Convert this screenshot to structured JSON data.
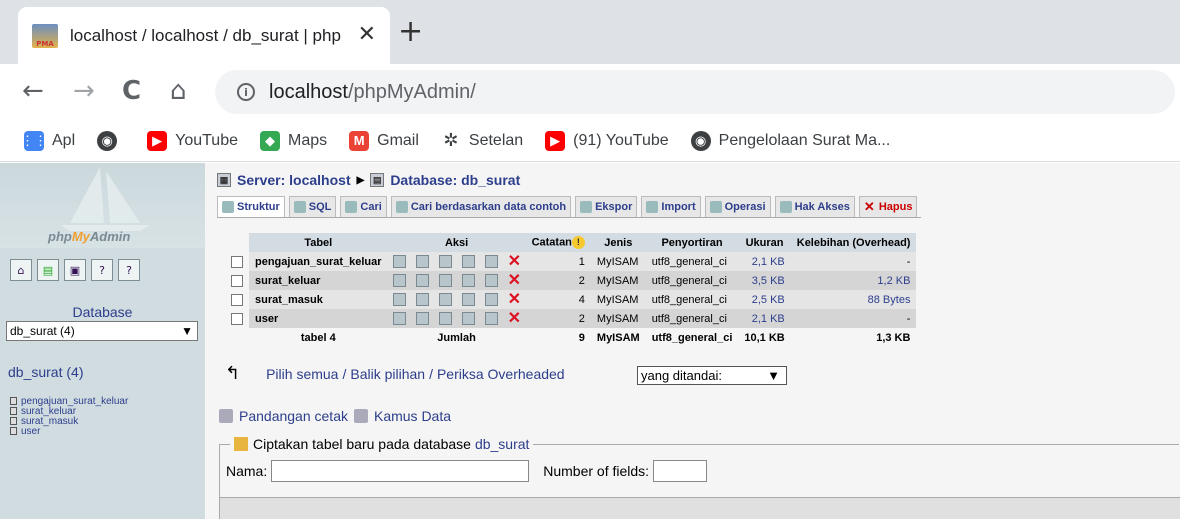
{
  "browser": {
    "tab_title": "localhost / localhost / db_surat | php",
    "tab_close": "✕",
    "new_tab": "+",
    "nav": {
      "back": "←",
      "forward": "→",
      "reload": "C",
      "home": "⌂"
    },
    "url_host": "localhost",
    "url_path": "/phpMyAdmin/",
    "bookmarks": [
      {
        "label": "Apl",
        "icon": "apps-grid-icon",
        "color": "#4285f4"
      },
      {
        "label": "",
        "icon": "globe-icon",
        "color": "#3c4043"
      },
      {
        "label": "YouTube",
        "icon": "youtube-icon",
        "color": "#ff0000"
      },
      {
        "label": "Maps",
        "icon": "maps-icon",
        "color": "#34a853"
      },
      {
        "label": "Gmail",
        "icon": "gmail-icon",
        "color": "#ea4335"
      },
      {
        "label": "Setelan",
        "icon": "gear-icon",
        "color": "#3c4043"
      },
      {
        "label": "(91) YouTube",
        "icon": "youtube-icon",
        "color": "#ff0000"
      },
      {
        "label": "Pengelolaan Surat Ma...",
        "icon": "globe-icon",
        "color": "#3c4043"
      }
    ]
  },
  "left": {
    "logo_php": "php",
    "logo_my": "My",
    "logo_admin": "Admin",
    "db_label": "Database",
    "db_select": "db_surat (4)",
    "db_title": "db_surat (4)",
    "tables": [
      "pengajuan_surat_keluar",
      "surat_keluar",
      "surat_masuk",
      "user"
    ]
  },
  "right": {
    "server": "Server: localhost",
    "database": "Database: db_surat",
    "tabs": [
      "Struktur",
      "SQL",
      "Cari",
      "Cari berdasarkan data contoh",
      "Ekspor",
      "Import",
      "Operasi",
      "Hak Akses",
      "Hapus"
    ],
    "table": {
      "headers": {
        "tabel": "Tabel",
        "aksi": "Aksi",
        "catatan": "Catatan",
        "jenis": "Jenis",
        "penyortiran": "Penyortiran",
        "ukuran": "Ukuran",
        "overhead": "Kelebihan (Overhead)"
      },
      "rows": [
        {
          "name": "pengajuan_surat_keluar",
          "records": "1",
          "type": "MyISAM",
          "collation": "utf8_general_ci",
          "size": "2,1 KB",
          "overhead": "-"
        },
        {
          "name": "surat_keluar",
          "records": "2",
          "type": "MyISAM",
          "collation": "utf8_general_ci",
          "size": "3,5 KB",
          "overhead": "1,2 KB"
        },
        {
          "name": "surat_masuk",
          "records": "4",
          "type": "MyISAM",
          "collation": "utf8_general_ci",
          "size": "2,5 KB",
          "overhead": "88 Bytes"
        },
        {
          "name": "user",
          "records": "2",
          "type": "MyISAM",
          "collation": "utf8_general_ci",
          "size": "2,1 KB",
          "overhead": "-"
        }
      ],
      "footer": {
        "tabel": "tabel 4",
        "jumlah": "Jumlah",
        "records": "9",
        "type": "MyISAM",
        "collation": "utf8_general_ci",
        "size": "10,1 KB",
        "overhead": "1,3 KB"
      }
    },
    "select_all": "Pilih semua",
    "invert": "Balik pilihan",
    "check_overhead": "Periksa Overheaded",
    "sep": "/",
    "with_marked": "yang ditandai:",
    "print_view": "Pandangan cetak",
    "data_dict": "Kamus Data",
    "create_legend": "Ciptakan tabel baru pada database",
    "create_db": "db_surat",
    "name_label": "Nama:",
    "fields_label": "Number of fields:"
  }
}
